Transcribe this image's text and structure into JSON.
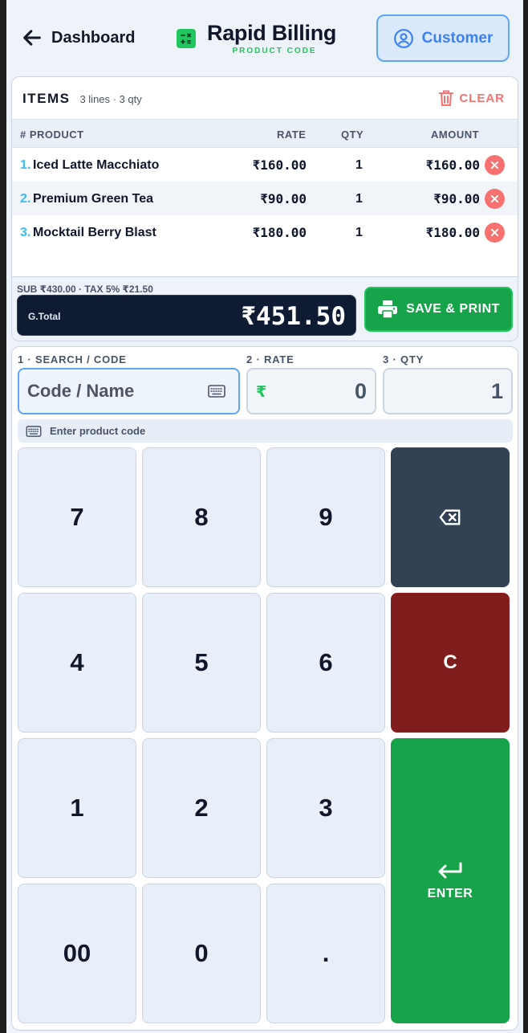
{
  "header": {
    "back_label": "Dashboard",
    "title": "Rapid Billing",
    "subtitle": "PRODUCT CODE",
    "customer_label": "Customer"
  },
  "items": {
    "title": "ITEMS",
    "meta": "3 lines · 3 qty",
    "clear_label": "CLEAR",
    "columns": {
      "num_product": "# PRODUCT",
      "rate": "RATE",
      "qty": "QTY",
      "amount": "AMOUNT"
    },
    "rows": [
      {
        "idx": "1.",
        "name": "Iced Latte Macchiato",
        "rate": "₹160.00",
        "qty": "1",
        "amount": "₹160.00"
      },
      {
        "idx": "2.",
        "name": "Premium Green Tea",
        "rate": "₹90.00",
        "qty": "1",
        "amount": "₹90.00"
      },
      {
        "idx": "3.",
        "name": "Mocktail Berry Blast",
        "rate": "₹180.00",
        "qty": "1",
        "amount": "₹180.00"
      }
    ]
  },
  "totals": {
    "subline": "SUB ₹430.00 · TAX 5% ₹21.50",
    "grand_label": "G.Total",
    "grand_value": "₹451.50",
    "save_print_label": "SAVE & PRINT"
  },
  "input": {
    "search_label": "1 · SEARCH / CODE",
    "search_placeholder": "Code / Name",
    "rate_label": "2 · RATE",
    "rate_currency": "₹",
    "rate_value": "0",
    "qty_label": "3 · QTY",
    "qty_value": "1",
    "hint": "Enter product code"
  },
  "keypad": {
    "k7": "7",
    "k8": "8",
    "k9": "9",
    "k4": "4",
    "k5": "5",
    "k6": "6",
    "k1": "1",
    "k2": "2",
    "k3": "3",
    "k00": "00",
    "k0": "0",
    "kdot": ".",
    "clear": "C",
    "enter": "ENTER"
  },
  "colors": {
    "accent_green": "#16a34a",
    "accent_blue": "#3b82f6",
    "danger": "#f87171",
    "dark_navy": "#0f1b33",
    "clear_key": "#7f1d1d"
  }
}
